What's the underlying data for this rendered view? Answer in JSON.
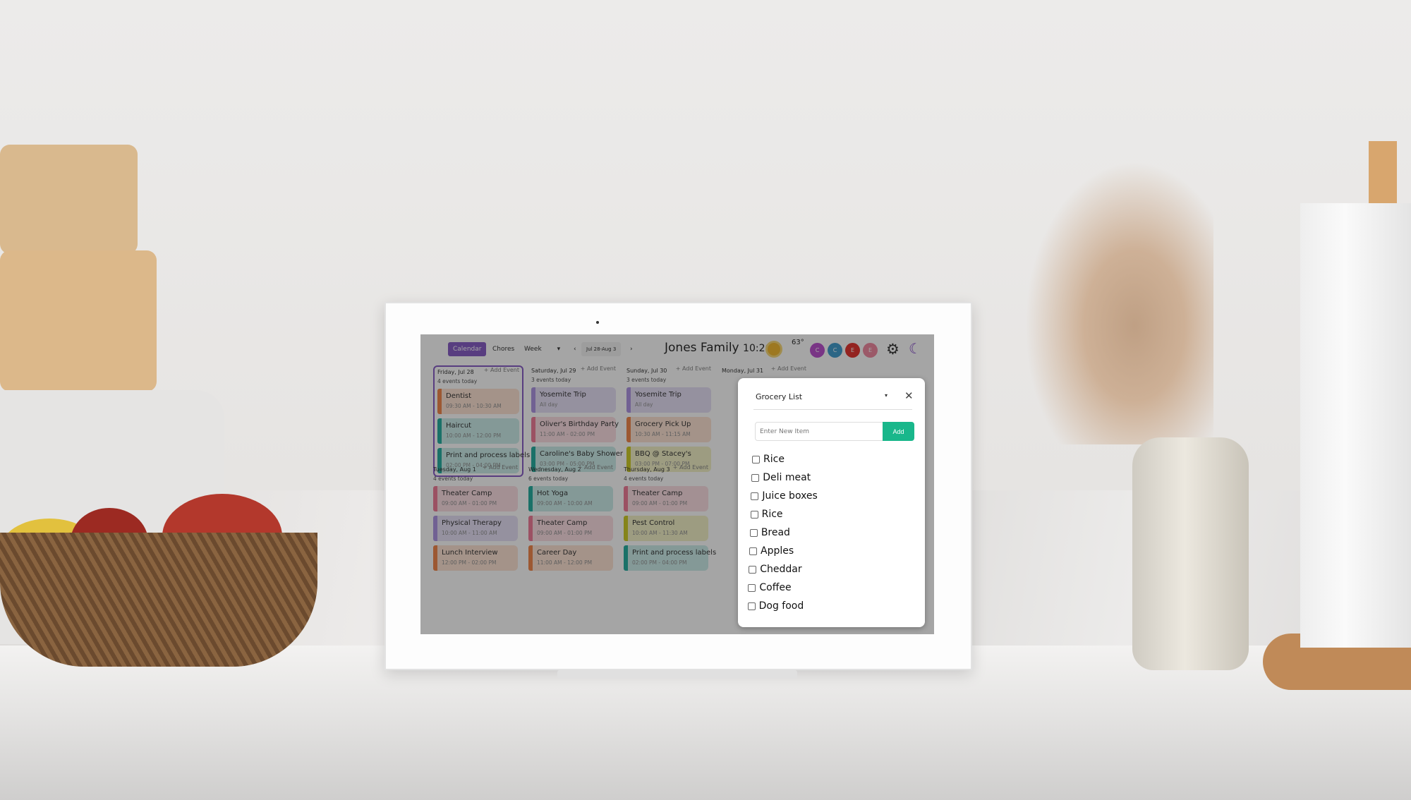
{
  "header": {
    "tabs": [
      "Calendar",
      "Chores"
    ],
    "view": "Week",
    "view_caret": "▾",
    "prev": "‹",
    "next": "›",
    "range": "Jul 28-Aug 3",
    "title": "Jones Family",
    "time": "10:26",
    "temperature": "63°",
    "weather_icon": "sun-icon",
    "avatars": [
      {
        "initial": "C",
        "color": "#b43ec9"
      },
      {
        "initial": "C",
        "color": "#2f93c9"
      },
      {
        "initial": "E",
        "color": "#e0201b"
      },
      {
        "initial": "E",
        "color": "#ee7d96"
      }
    ],
    "settings_icon": "⚙",
    "sleep_icon": "☾"
  },
  "add_event": "+ Add Event",
  "days": [
    {
      "date": "Friday, Jul 28",
      "count": "4 events today",
      "events": [
        {
          "title": "Dentist",
          "time": "09:30 AM - 10:30 AM",
          "color": "#f07a3a",
          "bg": "#fde0cf"
        },
        {
          "title": "Haircut",
          "time": "10:00 AM - 12:00 PM",
          "color": "#10a597",
          "bg": "#c6ebe7"
        },
        {
          "title": "Print and process labels",
          "time": "02:00 PM - 04:00 PM",
          "color": "#10a597",
          "bg": "#c6ebe7"
        }
      ]
    },
    {
      "date": "Saturday, Jul 29",
      "count": "3 events today",
      "events": [
        {
          "title": "Yosemite Trip",
          "time": "All day",
          "color": "#a58be0",
          "bg": "#e3dcf5"
        },
        {
          "title": "Oliver's Birthday Party",
          "time": "11:00 AM - 02:00 PM",
          "color": "#ee6f8e",
          "bg": "#fbdbe1"
        },
        {
          "title": "Caroline's Baby Shower",
          "time": "03:00 PM - 05:00 PM",
          "color": "#10a597",
          "bg": "#c6ebe7"
        }
      ]
    },
    {
      "date": "Sunday, Jul 30",
      "count": "3 events today",
      "events": [
        {
          "title": "Yosemite Trip",
          "time": "All day",
          "color": "#a58be0",
          "bg": "#e3dcf5"
        },
        {
          "title": "Grocery Pick Up",
          "time": "10:30 AM - 11:15 AM",
          "color": "#f07a3a",
          "bg": "#fde0cf"
        },
        {
          "title": "BBQ @ Stacey's",
          "time": "03:00 PM - 07:00 PM",
          "color": "#c9c712",
          "bg": "#f1f0c2"
        }
      ]
    },
    {
      "date": "Monday, Jul 31",
      "count": "",
      "events": []
    },
    {
      "date": "Tuesday, Aug 1",
      "count": "4 events today",
      "events": [
        {
          "title": "Theater Camp",
          "time": "09:00 AM - 01:00 PM",
          "color": "#ee6f8e",
          "bg": "#fbdbe1"
        },
        {
          "title": "Physical Therapy",
          "time": "10:00 AM - 11:00 AM",
          "color": "#a58be0",
          "bg": "#e3dcf5"
        },
        {
          "title": "Lunch Interview",
          "time": "12:00 PM - 02:00 PM",
          "color": "#f07a3a",
          "bg": "#fde0cf"
        }
      ]
    },
    {
      "date": "Wednesday, Aug 2",
      "count": "6 events today",
      "events": [
        {
          "title": "Hot Yoga",
          "time": "09:00 AM - 10:00 AM",
          "color": "#10a597",
          "bg": "#c6ebe7"
        },
        {
          "title": "Theater Camp",
          "time": "09:00 AM - 01:00 PM",
          "color": "#ee6f8e",
          "bg": "#fbdbe1"
        },
        {
          "title": "Career Day",
          "time": "11:00 AM - 12:00 PM",
          "color": "#f07a3a",
          "bg": "#fde0cf"
        }
      ]
    },
    {
      "date": "Thursday, Aug 3",
      "count": "4 events today",
      "events": [
        {
          "title": "Theater Camp",
          "time": "09:00 AM - 01:00 PM",
          "color": "#ee6f8e",
          "bg": "#fbdbe1"
        },
        {
          "title": "Pest Control",
          "time": "10:00 AM - 11:30 AM",
          "color": "#c9c712",
          "bg": "#f1f0c2"
        },
        {
          "title": "Print and process labels",
          "time": "02:00 PM - 04:00 PM",
          "color": "#10a597",
          "bg": "#c6ebe7"
        }
      ]
    }
  ],
  "grocery": {
    "title": "Grocery List",
    "caret": "▾",
    "close": "✕",
    "placeholder": "Enter New Item",
    "add": "Add",
    "accent": "#19b78b",
    "items": [
      "Rice",
      "Deli meat",
      "Juice boxes",
      "Rice",
      "Bread",
      "Apples",
      "Cheddar",
      "Coffee",
      "Dog food"
    ]
  }
}
